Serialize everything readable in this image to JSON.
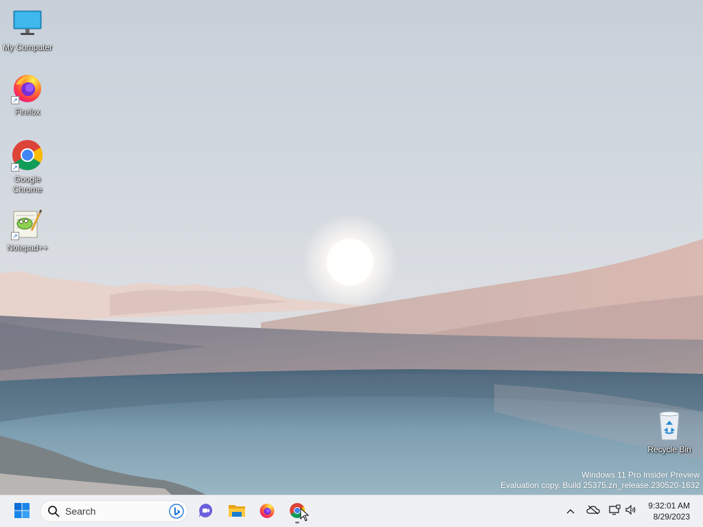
{
  "desktop": {
    "icons": [
      {
        "label": "My Computer",
        "icon": "monitor-icon",
        "shortcut": false
      },
      {
        "label": "Firefox",
        "icon": "firefox-icon",
        "shortcut": true
      },
      {
        "label": "Google\nChrome",
        "icon": "chrome-icon",
        "shortcut": true
      },
      {
        "label": "Notepad++",
        "icon": "notepadpp-icon",
        "shortcut": true
      },
      {
        "label": "Recycle Bin",
        "icon": "recycle-bin-icon",
        "shortcut": false
      }
    ],
    "shortcut_glyph": "↗"
  },
  "watermark": {
    "line1": "Windows 11 Pro Insider Preview",
    "line2": "Evaluation copy. Build 25375.zn_release.230520-1632"
  },
  "taskbar": {
    "search_placeholder": "Search",
    "apps": [
      "start-icon",
      "search-icon",
      "bing-icon",
      "meet-icon",
      "file-explorer-icon",
      "firefox-icon",
      "chrome-icon"
    ],
    "tray": {
      "chevron": "^",
      "icons": [
        "onedrive-offline-icon",
        "network-icon",
        "volume-icon"
      ]
    },
    "clock": {
      "time": "9:32:01 AM",
      "date": "8/29/2023"
    }
  },
  "colors": {
    "taskbar_bg": "#eef0f3",
    "accent": "#0078d4"
  }
}
